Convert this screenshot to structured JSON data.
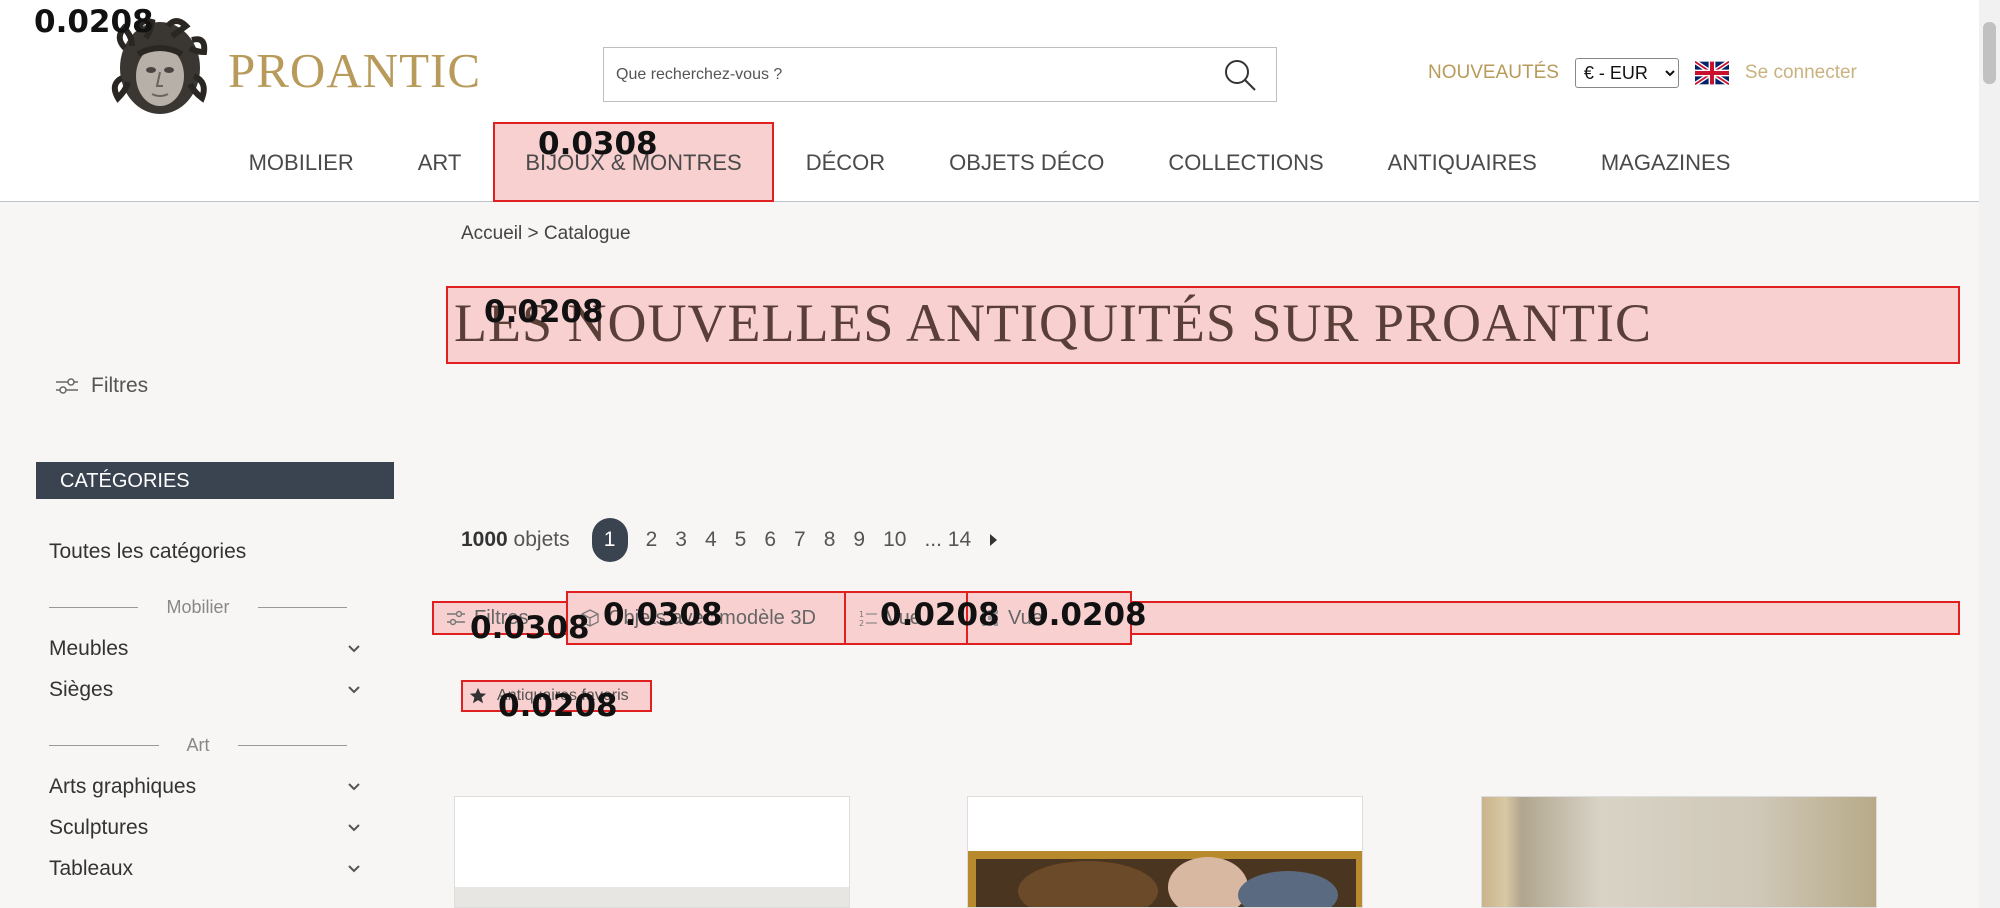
{
  "header": {
    "logo_text": "PROANTIC",
    "search_placeholder": "Que recherchez-vous ?",
    "nouveautes": "NOUVEAUTÉS",
    "currency": "€ - EUR",
    "login": "Se connecter"
  },
  "nav": [
    "MOBILIER",
    "ART",
    "BIJOUX & MONTRES",
    "DÉCOR",
    "OBJETS DÉCO",
    "COLLECTIONS",
    "ANTIQUAIRES",
    "MAGAZINES"
  ],
  "sidebar": {
    "filters_label": "Filtres",
    "categories_header": "CATÉGORIES",
    "all_categories": "Toutes les catégories",
    "group_mobilier": "Mobilier",
    "item_meubles": "Meubles",
    "item_sieges": "Sièges",
    "group_art": "Art",
    "item_arts_graphiques": "Arts graphiques",
    "item_sculptures": "Sculptures",
    "item_tableaux": "Tableaux"
  },
  "main": {
    "breadcrumb": "Accueil > Catalogue",
    "title": "LES NOUVELLES ANTIQUITÉS SUR PROANTIC",
    "count_number": "1000",
    "count_label": " objets",
    "pages": [
      "1",
      "2",
      "3",
      "4",
      "5",
      "6",
      "7",
      "8",
      "9",
      "10"
    ],
    "pages_more": "... 14",
    "toolbar": {
      "filters": "Filtres",
      "model3d": "Objets avec modèle 3D",
      "sort": "Vue",
      "view": "Vue"
    },
    "favorites": "Antiquaires favoris"
  },
  "scores": {
    "logo": "0.0208",
    "nav_bijoux": "0.0308",
    "title": "0.0208",
    "toolbar_filters": "0.0308",
    "toolbar_3d": "0.0308",
    "toolbar_sort": "0.0208",
    "toolbar_view": "0.0208",
    "favorites": "0.0208"
  }
}
